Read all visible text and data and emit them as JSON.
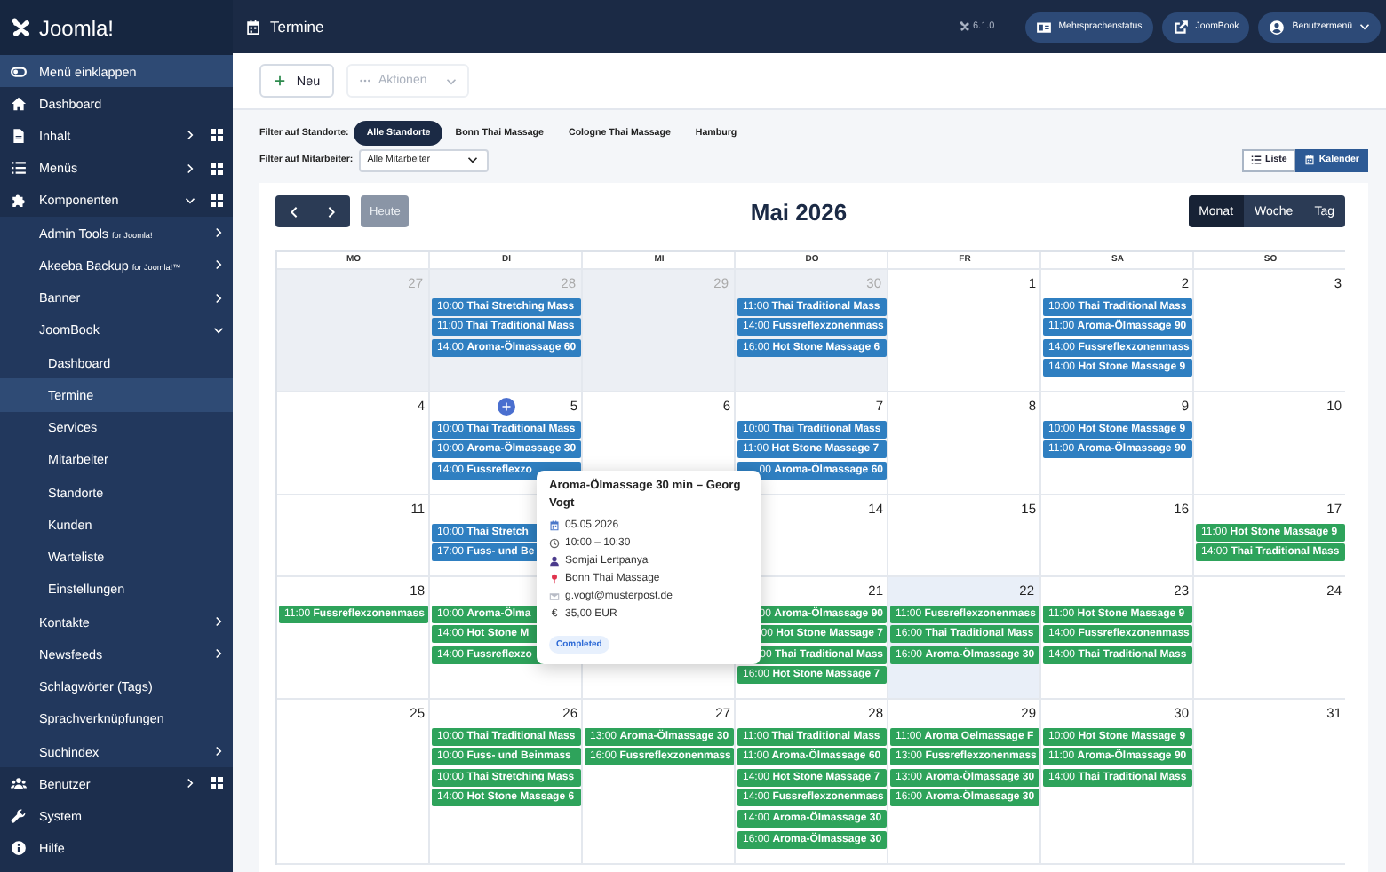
{
  "brand": {
    "name": "Joomla!"
  },
  "collapse_button": {
    "label": "Menü einklappen"
  },
  "sidebar": {
    "items": [
      {
        "label": "Dashboard",
        "selected": false
      },
      {
        "label": "Inhalt",
        "selected": false,
        "expanded": false,
        "has_dashboard": true
      },
      {
        "label": "Menüs",
        "selected": false,
        "expanded": false,
        "has_dashboard": true
      },
      {
        "label": "Komponenten",
        "selected": false,
        "expanded": true,
        "has_dashboard": true,
        "children": [
          {
            "label": "Admin Tools",
            "suffix": "for Joomla!",
            "selected": false,
            "expanded": false
          },
          {
            "label": "Akeeba Backup",
            "suffix": "for Joomla!™",
            "selected": false,
            "expanded": false
          },
          {
            "label": "Banner",
            "selected": false,
            "expanded": false
          },
          {
            "label": "JoomBook",
            "selected": false,
            "expanded": true,
            "children": [
              {
                "label": "Dashboard",
                "selected": false
              },
              {
                "label": "Termine",
                "selected": true
              },
              {
                "label": "Services",
                "selected": false
              },
              {
                "label": "Mitarbeiter",
                "selected": false
              },
              {
                "label": "Standorte",
                "selected": false
              },
              {
                "label": "Kunden",
                "selected": false
              },
              {
                "label": "Warteliste",
                "selected": false
              },
              {
                "label": "Einstellungen",
                "selected": false
              }
            ]
          },
          {
            "label": "Kontakte",
            "selected": false,
            "expanded": false
          },
          {
            "label": "Newsfeeds",
            "selected": false,
            "expanded": false
          },
          {
            "label": "Schlagwörter (Tags)",
            "selected": false
          },
          {
            "label": "Sprachverknüpfungen",
            "selected": false
          },
          {
            "label": "Suchindex",
            "selected": false,
            "expanded": false
          }
        ]
      },
      {
        "label": "Benutzer",
        "selected": false,
        "expanded": false,
        "has_dashboard": true
      },
      {
        "label": "System",
        "selected": false
      },
      {
        "label": "Hilfe",
        "selected": false
      }
    ]
  },
  "header": {
    "title": "Termine",
    "version": "6.1.0",
    "buttons": [
      {
        "label": "Mehrsprachenstatus"
      },
      {
        "label": "JoomBook"
      },
      {
        "label": "Benutzermenü"
      }
    ]
  },
  "toolbar": {
    "new_button": {
      "label": "Neu"
    },
    "actions_button": {
      "label": "Aktionen",
      "disabled": true
    }
  },
  "filters": {
    "location_label": "Filter auf Standorte:",
    "locations": [
      {
        "label": "Alle Standorte",
        "selected": true
      },
      {
        "label": "Bonn Thai Massage",
        "selected": false
      },
      {
        "label": "Cologne Thai Massage",
        "selected": false
      },
      {
        "label": "Hamburg",
        "selected": false
      }
    ],
    "staff_label": "Filter auf Mitarbeiter:",
    "staff_select": {
      "value": "Alle Mitarbeiter"
    }
  },
  "view_switch": [
    {
      "label": "Liste",
      "selected": false
    },
    {
      "label": "Kalender",
      "selected": true
    }
  ],
  "calendar": {
    "title": "Mai 2026",
    "today_button": {
      "label": "Heute",
      "disabled": true
    },
    "views": [
      {
        "label": "Monat",
        "selected": true
      },
      {
        "label": "Woche",
        "selected": false
      },
      {
        "label": "Tag",
        "selected": false
      }
    ],
    "weekdays": [
      "MO",
      "DI",
      "MI",
      "DO",
      "FR",
      "SA",
      "SO"
    ],
    "weeks": [
      {
        "mo": {
          "date": "27",
          "muted": true,
          "today": false
        },
        "di": {
          "date": "28",
          "muted": true,
          "today": false,
          "events": [
            {
              "time": "10:00",
              "title": "Thai Stretching Mass",
              "color": "#2f7fc1"
            },
            {
              "time": "11:00",
              "title": "Thai Traditional Mass",
              "color": "#2f7fc1"
            },
            {
              "time": "14:00",
              "title": "Aroma-Ölmassage 60",
              "color": "#2f7fc1"
            }
          ]
        },
        "mi": {
          "date": "29",
          "muted": true,
          "today": false
        },
        "do": {
          "date": "30",
          "muted": true,
          "today": false,
          "events": [
            {
              "time": "11:00",
              "title": "Thai Traditional Mass",
              "color": "#2f7fc1"
            },
            {
              "time": "14:00",
              "title": "Fussreflexzonenmass",
              "color": "#2f7fc1"
            },
            {
              "time": "16:00",
              "title": "Hot Stone Massage 6",
              "color": "#2f7fc1"
            }
          ]
        },
        "fr": {
          "date": "1",
          "muted": false,
          "today": false
        },
        "sa": {
          "date": "2",
          "muted": false,
          "today": false,
          "events": [
            {
              "time": "10:00",
              "title": "Thai Traditional Mass",
              "color": "#2f7fc1"
            },
            {
              "time": "11:00",
              "title": "Aroma-Ölmassage 90",
              "color": "#2f7fc1"
            },
            {
              "time": "14:00",
              "title": "Fussreflexzonenmass",
              "color": "#2f7fc1"
            },
            {
              "time": "14:00",
              "title": "Hot Stone Massage 9",
              "color": "#2f7fc1"
            }
          ]
        },
        "so": {
          "date": "3",
          "muted": false,
          "today": false
        }
      },
      {
        "mo": {
          "date": "4",
          "muted": false,
          "today": false
        },
        "di": {
          "date": "5",
          "muted": false,
          "today": false,
          "add_button": true,
          "events": [
            {
              "time": "10:00",
              "title": "Thai Traditional Mass",
              "color": "#2f7fc1"
            },
            {
              "time": "10:00",
              "title": "Aroma-Ölmassage 30",
              "color": "#2f7fc1"
            },
            {
              "time": "14:00",
              "title": "Fussreflexzo",
              "color": "#2f7fc1"
            }
          ],
          "popover": {
            "title": "Aroma-Ölmassage 30 min – Georg Vogt",
            "details": [
              {
                "kind": "date",
                "text": "05.05.2026"
              },
              {
                "kind": "time",
                "text": "10:00 – 10:30"
              },
              {
                "kind": "staff",
                "text": "Somjai Lertpanya"
              },
              {
                "kind": "location",
                "text": "Bonn Thai Massage"
              },
              {
                "kind": "email",
                "text": "g.vogt@musterpost.de"
              },
              {
                "kind": "price",
                "symbol": "€",
                "text": "35,00 EUR"
              }
            ],
            "status": "Completed"
          }
        },
        "mi": {
          "date": "6",
          "muted": false,
          "today": false
        },
        "do": {
          "date": "7",
          "muted": false,
          "today": false,
          "events": [
            {
              "time": "10:00",
              "title": "Thai Traditional Mass",
              "color": "#2f7fc1"
            },
            {
              "time": "11:00",
              "title": "Hot Stone Massage 7",
              "color": "#2f7fc1"
            },
            {
              "time": "00",
              "title": "Aroma-Ölmassage 60",
              "color": "#2f7fc1",
              "cut_left": true
            }
          ]
        },
        "fr": {
          "date": "8",
          "muted": false,
          "today": false
        },
        "sa": {
          "date": "9",
          "muted": false,
          "today": false,
          "events": [
            {
              "time": "10:00",
              "title": "Hot Stone Massage 9",
              "color": "#2f7fc1"
            },
            {
              "time": "11:00",
              "title": "Aroma-Ölmassage 90",
              "color": "#2f7fc1"
            }
          ]
        },
        "so": {
          "date": "10",
          "muted": false,
          "today": false
        }
      },
      {
        "mo": {
          "date": "11",
          "muted": false,
          "today": false
        },
        "di": {
          "events": [
            {
              "time": "10:00",
              "title": "Thai Stretch",
              "color": "#2f7fc1"
            },
            {
              "time": "17:00",
              "title": "Fuss- und Be",
              "color": "#2f7fc1"
            }
          ]
        },
        "do": {
          "date": "14",
          "muted": false,
          "today": false
        },
        "fr": {
          "date": "15",
          "muted": false,
          "today": false
        },
        "sa": {
          "date": "16",
          "muted": false,
          "today": false
        },
        "so": {
          "date": "17",
          "muted": false,
          "today": false,
          "events": [
            {
              "time": "11:00",
              "title": "Hot Stone Massage 9",
              "color": "#2ea35b"
            },
            {
              "time": "14:00",
              "title": "Thai Traditional Mass",
              "color": "#2ea35b"
            }
          ]
        }
      },
      {
        "mo": {
          "date": "18",
          "muted": false,
          "today": false,
          "events": [
            {
              "time": "11:00",
              "title": "Fussreflexzonenmass",
              "color": "#2ea35b"
            }
          ]
        },
        "di": {
          "events": [
            {
              "time": "10:00",
              "title": "Aroma-Ölma",
              "color": "#2ea35b"
            },
            {
              "time": "14:00",
              "title": "Hot Stone M",
              "color": "#2ea35b"
            },
            {
              "time": "14:00",
              "title": "Fussreflexzo",
              "color": "#2ea35b"
            }
          ]
        },
        "do": {
          "date": "21",
          "muted": false,
          "today": false,
          "events": [
            {
              "time": "00",
              "title": "Aroma-Ölmassage 90",
              "color": "#2ea35b",
              "cut_left": true
            },
            {
              "time": "00",
              "title": "Hot Stone Massage 7",
              "color": "#2ea35b",
              "cut_left": true
            },
            {
              "time": "00",
              "title": "Thai Traditional Mass",
              "color": "#2ea35b",
              "cut_left": true
            },
            {
              "time": "16:00",
              "title": "Hot Stone Massage 7",
              "color": "#2ea35b"
            }
          ]
        },
        "fr": {
          "date": "22",
          "muted": false,
          "today": true,
          "events": [
            {
              "time": "11:00",
              "title": "Fussreflexzonenmass",
              "color": "#2ea35b"
            },
            {
              "time": "16:00",
              "title": "Thai Traditional Mass",
              "color": "#2ea35b"
            },
            {
              "time": "16:00",
              "title": "Aroma-Ölmassage 30",
              "color": "#2ea35b"
            }
          ]
        },
        "sa": {
          "date": "23",
          "muted": false,
          "today": false,
          "events": [
            {
              "time": "11:00",
              "title": "Hot Stone Massage 9",
              "color": "#2ea35b"
            },
            {
              "time": "14:00",
              "title": "Fussreflexzonenmass",
              "color": "#2ea35b"
            },
            {
              "time": "14:00",
              "title": "Thai Traditional Mass",
              "color": "#2ea35b"
            }
          ]
        },
        "so": {
          "date": "24",
          "muted": false,
          "today": false
        }
      },
      {
        "mo": {
          "date": "25",
          "muted": false,
          "today": false
        },
        "di": {
          "date": "26",
          "muted": false,
          "today": false,
          "events": [
            {
              "time": "10:00",
              "title": "Thai Traditional Mass",
              "color": "#2ea35b"
            },
            {
              "time": "10:00",
              "title": "Fuss- und Beinmass",
              "color": "#2ea35b"
            },
            {
              "time": "10:00",
              "title": "Thai Stretching Mass",
              "color": "#2ea35b"
            },
            {
              "time": "14:00",
              "title": "Hot Stone Massage 6",
              "color": "#2ea35b"
            }
          ]
        },
        "mi": {
          "date": "27",
          "muted": false,
          "today": false,
          "events": [
            {
              "time": "13:00",
              "title": "Aroma-Ölmassage 30",
              "color": "#2ea35b"
            },
            {
              "time": "16:00",
              "title": "Fussreflexzonenmass",
              "color": "#2ea35b"
            }
          ]
        },
        "do": {
          "date": "28",
          "muted": false,
          "today": false,
          "events": [
            {
              "time": "11:00",
              "title": "Thai Traditional Mass",
              "color": "#2ea35b"
            },
            {
              "time": "11:00",
              "title": "Aroma-Ölmassage 60",
              "color": "#2ea35b"
            },
            {
              "time": "14:00",
              "title": "Hot Stone Massage 7",
              "color": "#2ea35b"
            },
            {
              "time": "14:00",
              "title": "Fussreflexzonenmass",
              "color": "#2ea35b"
            },
            {
              "time": "14:00",
              "title": "Aroma-Ölmassage 30",
              "color": "#2ea35b"
            },
            {
              "time": "16:00",
              "title": "Aroma-Ölmassage 30",
              "color": "#2ea35b"
            }
          ]
        },
        "fr": {
          "date": "29",
          "muted": false,
          "today": false,
          "events": [
            {
              "time": "11:00",
              "title": "Aroma Oelmassage F",
              "color": "#2ea35b"
            },
            {
              "time": "13:00",
              "title": "Fussreflexzonenmass",
              "color": "#2ea35b"
            },
            {
              "time": "13:00",
              "title": "Aroma-Ölmassage 30",
              "color": "#2ea35b"
            },
            {
              "time": "16:00",
              "title": "Aroma-Ölmassage 30",
              "color": "#2ea35b"
            }
          ]
        },
        "sa": {
          "date": "30",
          "muted": false,
          "today": false,
          "events": [
            {
              "time": "10:00",
              "title": "Hot Stone Massage 9",
              "color": "#2ea35b"
            },
            {
              "time": "11:00",
              "title": "Aroma-Ölmassage 90",
              "color": "#2ea35b"
            },
            {
              "time": "14:00",
              "title": "Thai Traditional Mass",
              "color": "#2ea35b"
            }
          ]
        },
        "so": {
          "date": "31",
          "muted": false,
          "today": false
        }
      }
    ]
  }
}
